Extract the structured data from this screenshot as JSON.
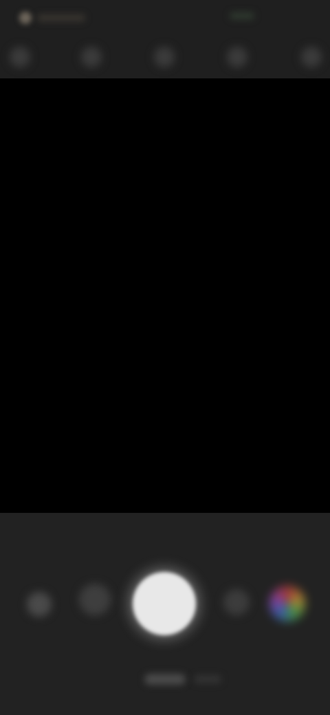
{
  "status_bar": {
    "left_icon": "app-notification-icon",
    "right_indicator": "battery-indicator-icon"
  },
  "top_toolbar": {
    "items": [
      {
        "icon": "settings-icon"
      },
      {
        "icon": "flash-icon"
      },
      {
        "icon": "timer-icon"
      },
      {
        "icon": "aspect-ratio-icon"
      },
      {
        "icon": "filter-icon"
      }
    ]
  },
  "bottom_controls": {
    "left_button_icon": "gallery-icon",
    "second_button_icon": "mode-switch-icon",
    "shutter_icon": "shutter-button",
    "fourth_button_icon": "camera-flip-icon",
    "lens_icon": "lens-selector-icon"
  },
  "colors": {
    "background": "#1c1c1c",
    "viewfinder": "#000000",
    "shutter": "#e8e8e8"
  }
}
